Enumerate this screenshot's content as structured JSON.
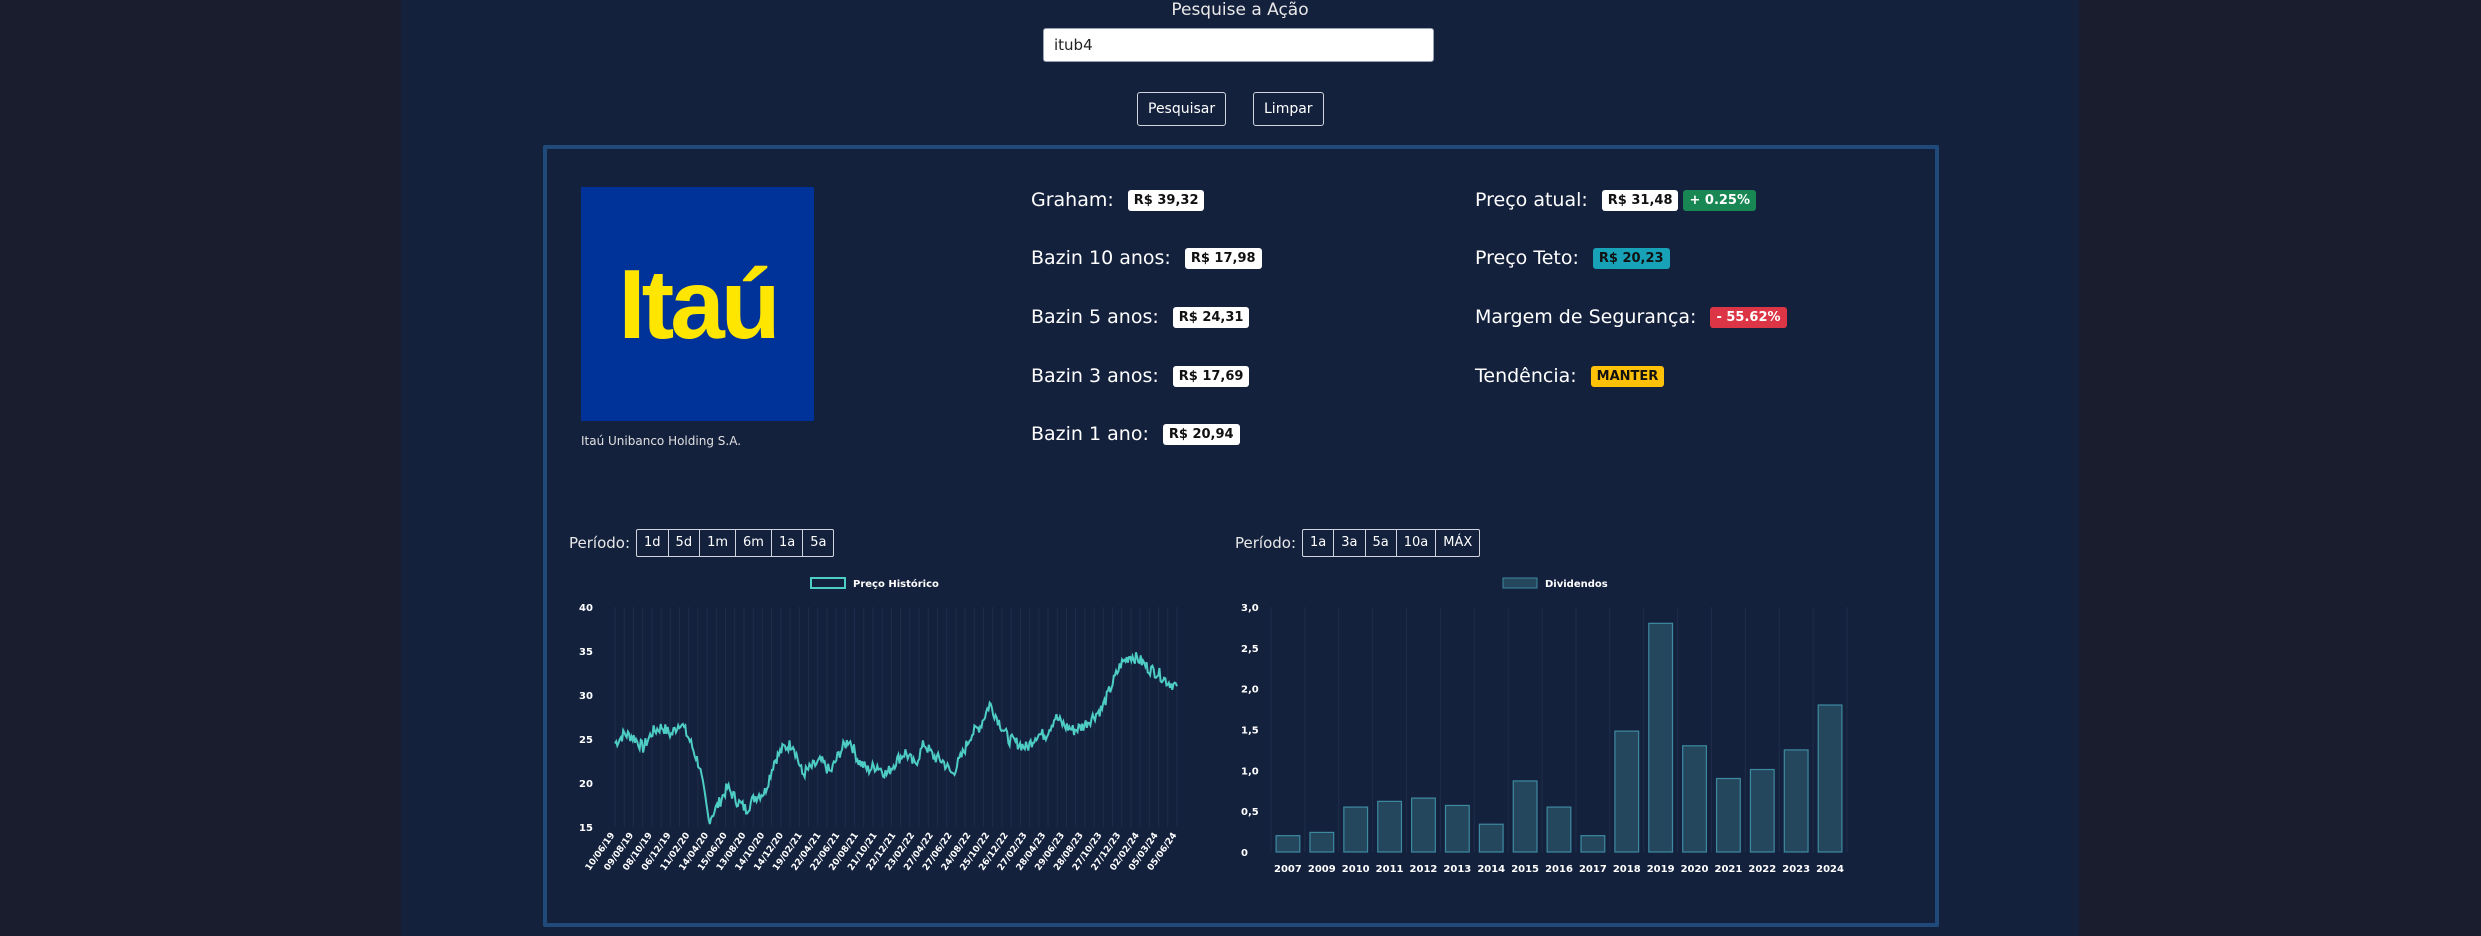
{
  "search": {
    "label": "Pesquise a Ação",
    "value": "itub4",
    "search_button": "Pesquisar",
    "clear_button": "Limpar"
  },
  "company": {
    "logo_text": "Itaú",
    "name": "Itaú Unibanco Holding S.A."
  },
  "metrics_left": [
    {
      "label": "Graham:",
      "value": "R$ 39,32"
    },
    {
      "label": "Bazin 10 anos:",
      "value": "R$ 17,98"
    },
    {
      "label": "Bazin 5 anos:",
      "value": "R$ 24,31"
    },
    {
      "label": "Bazin 3 anos:",
      "value": "R$ 17,69"
    },
    {
      "label": "Bazin 1 ano:",
      "value": "R$ 20,94"
    }
  ],
  "metrics_right": {
    "preco_atual": {
      "label": "Preço atual:",
      "value": "R$ 31,48",
      "change": "+ 0.25%"
    },
    "preco_teto": {
      "label": "Preço Teto:",
      "value": "R$ 20,23"
    },
    "margem": {
      "label": "Margem de Segurança:",
      "value": "- 55.62%"
    },
    "tendencia": {
      "label": "Tendência:",
      "value": "MANTER"
    }
  },
  "colors": {
    "background": "#14213d",
    "page_edge": "#1a1d2e",
    "card_border": "#1f4a7a",
    "logo_bg": "#003399",
    "logo_text": "#ffe600",
    "price_line": "#4ecdc4",
    "bar_fill": "#24475e",
    "bar_stroke": "#3e8aa0",
    "badge_green": "#198754",
    "badge_teal": "#17a2b8",
    "badge_red": "#dc3545",
    "badge_yellow": "#ffc107"
  },
  "price_period": {
    "label": "Período:",
    "options": [
      "1d",
      "5d",
      "1m",
      "6m",
      "1a",
      "5a"
    ]
  },
  "dividend_period": {
    "label": "Período:",
    "options": [
      "1a",
      "3a",
      "5a",
      "10a",
      "MÁX"
    ]
  },
  "chart_data": [
    {
      "type": "line",
      "legend": "Preço Histórico",
      "ylim": [
        15,
        40
      ],
      "yticks": [
        15,
        20,
        25,
        30,
        35,
        40
      ],
      "x_tick_labels": [
        "10/06/19",
        "09/08/19",
        "08/10/19",
        "06/12/19",
        "11/02/20",
        "14/04/20",
        "15/06/20",
        "13/08/20",
        "14/10/20",
        "14/12/20",
        "19/02/21",
        "22/04/21",
        "22/06/21",
        "20/08/21",
        "21/10/21",
        "22/12/21",
        "23/02/22",
        "27/04/22",
        "27/06/22",
        "24/08/22",
        "25/10/22",
        "26/12/22",
        "27/02/23",
        "28/04/23",
        "29/06/23",
        "28/08/23",
        "27/10/23",
        "27/12/23",
        "02/02/24",
        "05/03/24",
        "05/06/24"
      ],
      "x": [
        "2019-06",
        "2019-07",
        "2019-08",
        "2019-09",
        "2019-10",
        "2019-11",
        "2019-12",
        "2020-01",
        "2020-02",
        "2020-03",
        "2020-04",
        "2020-05",
        "2020-06",
        "2020-07",
        "2020-08",
        "2020-09",
        "2020-10",
        "2020-11",
        "2020-12",
        "2021-01",
        "2021-02",
        "2021-03",
        "2021-04",
        "2021-05",
        "2021-06",
        "2021-07",
        "2021-08",
        "2021-09",
        "2021-10",
        "2021-11",
        "2021-12",
        "2022-01",
        "2022-02",
        "2022-03",
        "2022-04",
        "2022-05",
        "2022-06",
        "2022-07",
        "2022-08",
        "2022-09",
        "2022-10",
        "2022-11",
        "2022-12",
        "2023-01",
        "2023-02",
        "2023-03",
        "2023-04",
        "2023-05",
        "2023-06",
        "2023-07",
        "2023-08",
        "2023-09",
        "2023-10",
        "2023-11",
        "2023-12",
        "2024-01",
        "2024-02",
        "2024-03",
        "2024-04",
        "2024-05",
        "2024-06"
      ],
      "values": [
        24.5,
        25.6,
        25.2,
        24.0,
        25.8,
        26.4,
        25.5,
        27.0,
        24.8,
        22.0,
        15.8,
        17.5,
        19.5,
        18.0,
        17.0,
        18.5,
        19.0,
        22.5,
        24.0,
        24.5,
        21.0,
        21.8,
        22.5,
        21.2,
        23.5,
        25.0,
        22.5,
        21.5,
        22.0,
        21.0,
        22.5,
        23.5,
        22.0,
        24.5,
        23.0,
        22.5,
        21.0,
        23.0,
        25.5,
        26.5,
        29.0,
        27.0,
        25.0,
        24.5,
        24.0,
        25.5,
        25.5,
        27.5,
        26.5,
        26.0,
        26.5,
        27.5,
        28.5,
        31.0,
        33.5,
        34.5,
        34.0,
        33.0,
        32.5,
        31.5,
        31.0
      ],
      "color": "#4ecdc4"
    },
    {
      "type": "bar",
      "legend": "Dividendos",
      "ylim": [
        0,
        3.0
      ],
      "yticks": [
        "0",
        "0,5",
        "1,0",
        "1,5",
        "2,0",
        "2,5",
        "3,0"
      ],
      "categories": [
        "2007",
        "2009",
        "2010",
        "2011",
        "2012",
        "2013",
        "2014",
        "2015",
        "2016",
        "2017",
        "2018",
        "2019",
        "2020",
        "2021",
        "2022",
        "2023",
        "2024"
      ],
      "values": [
        0.2,
        0.24,
        0.55,
        0.62,
        0.66,
        0.57,
        0.34,
        0.87,
        0.55,
        0.2,
        1.48,
        2.8,
        1.3,
        0.9,
        1.01,
        1.25,
        1.8
      ]
    }
  ]
}
